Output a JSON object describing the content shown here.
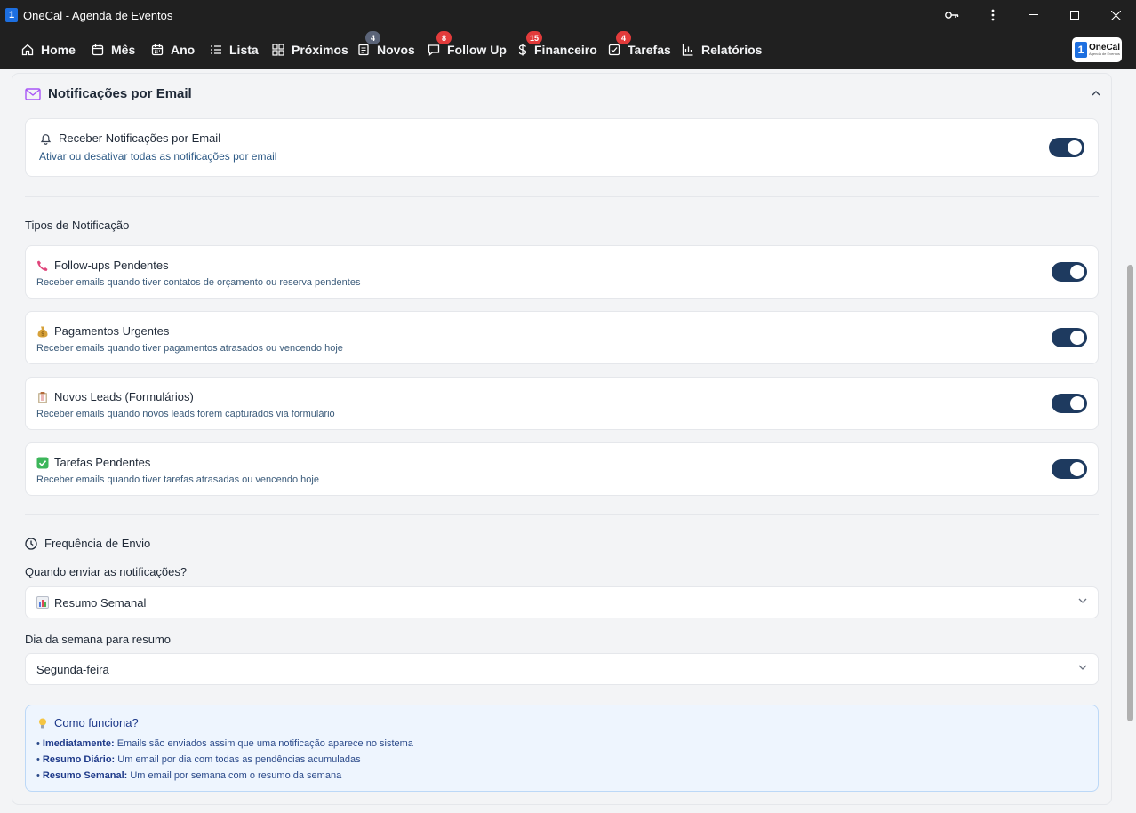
{
  "window": {
    "title": "OneCal - Agenda de Eventos",
    "app_icon": "1"
  },
  "nav": {
    "items": [
      {
        "label": "Home",
        "icon": "home-icon"
      },
      {
        "label": "Mês",
        "icon": "calendar-icon"
      },
      {
        "label": "Ano",
        "icon": "calendar-grid-icon"
      },
      {
        "label": "Lista",
        "icon": "list-icon"
      },
      {
        "label": "Próximos",
        "icon": "grid-icon"
      },
      {
        "label": "Novos",
        "icon": "document-icon",
        "badge": "4"
      },
      {
        "label": "Follow Up",
        "icon": "chat-icon",
        "badge": "8"
      },
      {
        "label": "Financeiro",
        "icon": "dollar-icon",
        "badge": "15"
      },
      {
        "label": "Tarefas",
        "icon": "check-square-icon",
        "badge": "4"
      },
      {
        "label": "Relatórios",
        "icon": "bar-chart-icon"
      }
    ],
    "logo": {
      "box": "1",
      "name": "OneCal",
      "sub": "Agenda de Eventos"
    }
  },
  "section": {
    "title": "Notificações por Email",
    "master": {
      "title": "Receber Notificações por Email",
      "description": "Ativar ou desativar todas as notificações por email",
      "enabled": true
    },
    "types_heading": "Tipos de Notificação",
    "types": [
      {
        "icon": "phone-icon",
        "title": "Follow-ups Pendentes",
        "description": "Receber emails quando tiver contatos de orçamento ou reserva pendentes",
        "enabled": true
      },
      {
        "icon": "money-bag-icon",
        "title": "Pagamentos Urgentes",
        "description": "Receber emails quando tiver pagamentos atrasados ou vencendo hoje",
        "enabled": true
      },
      {
        "icon": "clipboard-icon",
        "title": "Novos Leads (Formulários)",
        "description": "Receber emails quando novos leads forem capturados via formulário",
        "enabled": true
      },
      {
        "icon": "check-mark-icon",
        "title": "Tarefas Pendentes",
        "description": "Receber emails quando tiver tarefas atrasadas ou vencendo hoje",
        "enabled": true
      }
    ],
    "frequency": {
      "heading": "Frequência de Envio",
      "when_label": "Quando enviar as notificações?",
      "when_value": "Resumo Semanal",
      "day_label": "Dia da semana para resumo",
      "day_value": "Segunda-feira"
    },
    "info": {
      "title": "Como funciona?",
      "lines": [
        {
          "term": "Imediatamente:",
          "text": "Emails são enviados assim que uma notificação aparece no sistema"
        },
        {
          "term": "Resumo Diário:",
          "text": "Um email por dia com todas as pendências acumuladas"
        },
        {
          "term": "Resumo Semanal:",
          "text": "Um email por semana com o resumo da semana"
        }
      ]
    }
  }
}
